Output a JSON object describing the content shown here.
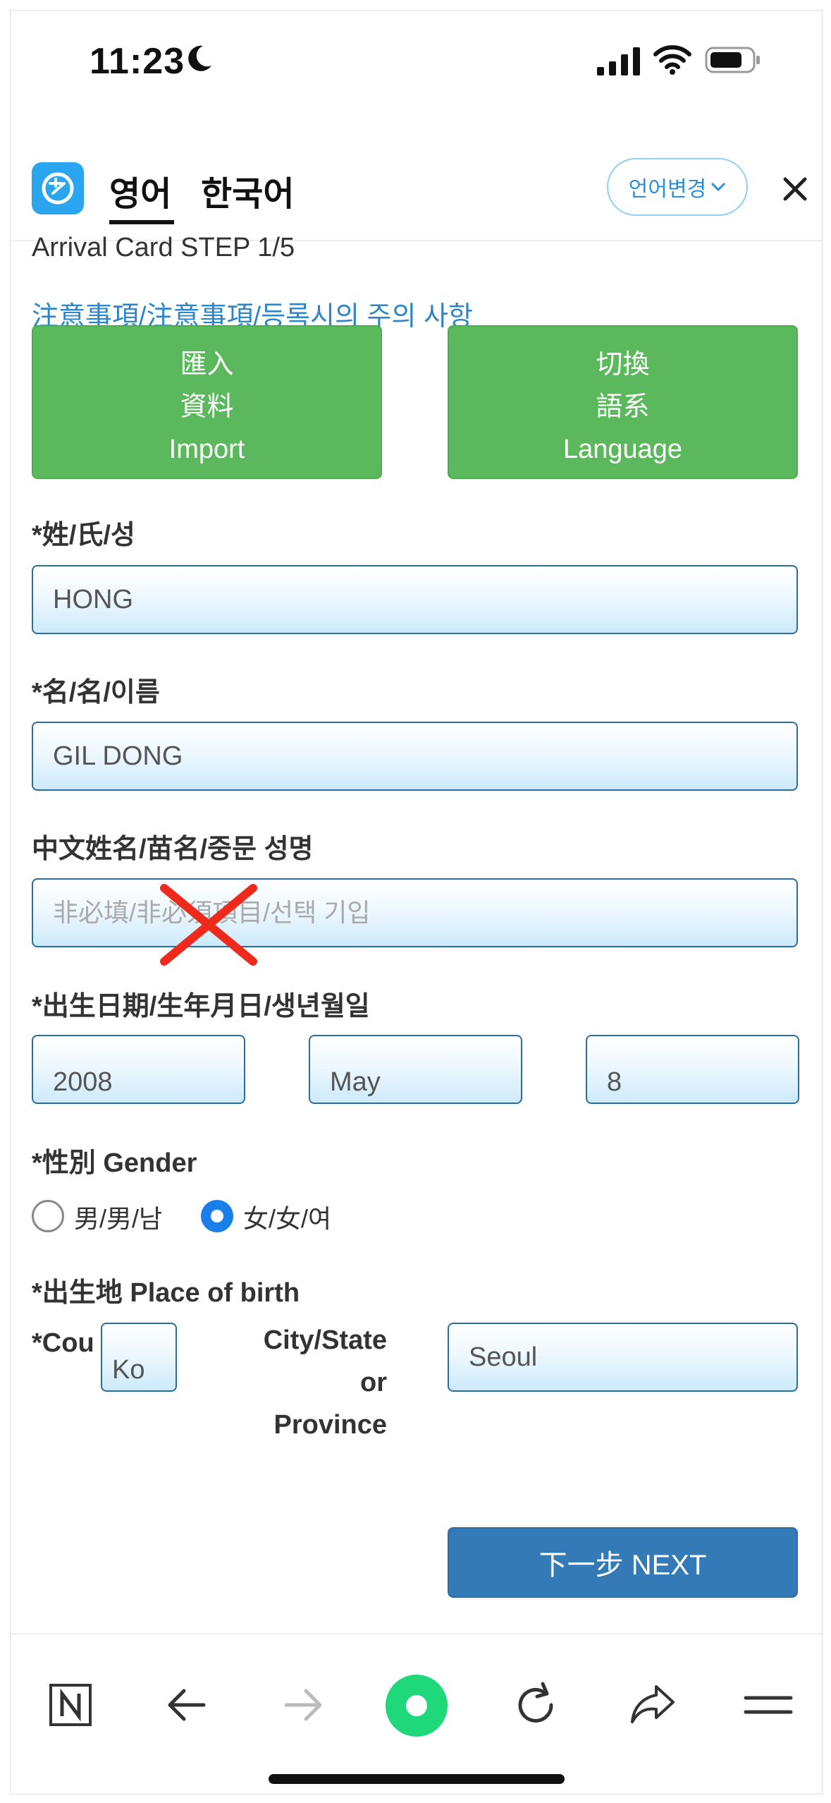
{
  "status_bar": {
    "time": "11:23"
  },
  "header": {
    "tabs": [
      {
        "label": "영어",
        "selected": true
      },
      {
        "label": "한국어",
        "selected": false
      }
    ],
    "language_button": "언어변경"
  },
  "form": {
    "step_title": "Arrival Card STEP 1/5",
    "notice_link": "注意事項/注意事項/등록시의 주의 사항",
    "import_button": [
      "匯入",
      "資料",
      "Import"
    ],
    "language_switch_button": [
      "切換",
      "語系",
      "Language"
    ],
    "surname": {
      "label": "*姓/氏/성",
      "value": "HONG"
    },
    "given_name": {
      "label": "*名/名/이름",
      "value": "GIL DONG"
    },
    "chinese_name": {
      "label": "中文姓名/苗名/중문 성명",
      "placeholder": "非必填/非必須項目/선택 기입"
    },
    "birth_date": {
      "label": "*出生日期/生年月日/생년월일",
      "year": "2008",
      "month": "May",
      "day": "8"
    },
    "gender": {
      "label": "*性別 Gender",
      "options": [
        "男/男/남",
        "女/女/여"
      ],
      "selected": "女/女/여"
    },
    "place_of_birth": {
      "label": "*出生地 Place of birth",
      "country_label": "*Cou",
      "country_value": "Ko",
      "city_label_lines": [
        "City/State",
        "or",
        "Province"
      ],
      "city_value": "Seoul"
    },
    "next_button": "下一步 NEXT"
  },
  "colors": {
    "accent_blue": "#337ab7",
    "green_button": "#5cb85c",
    "link": "#2e86c9",
    "radio_selected": "#1a7fe8"
  }
}
